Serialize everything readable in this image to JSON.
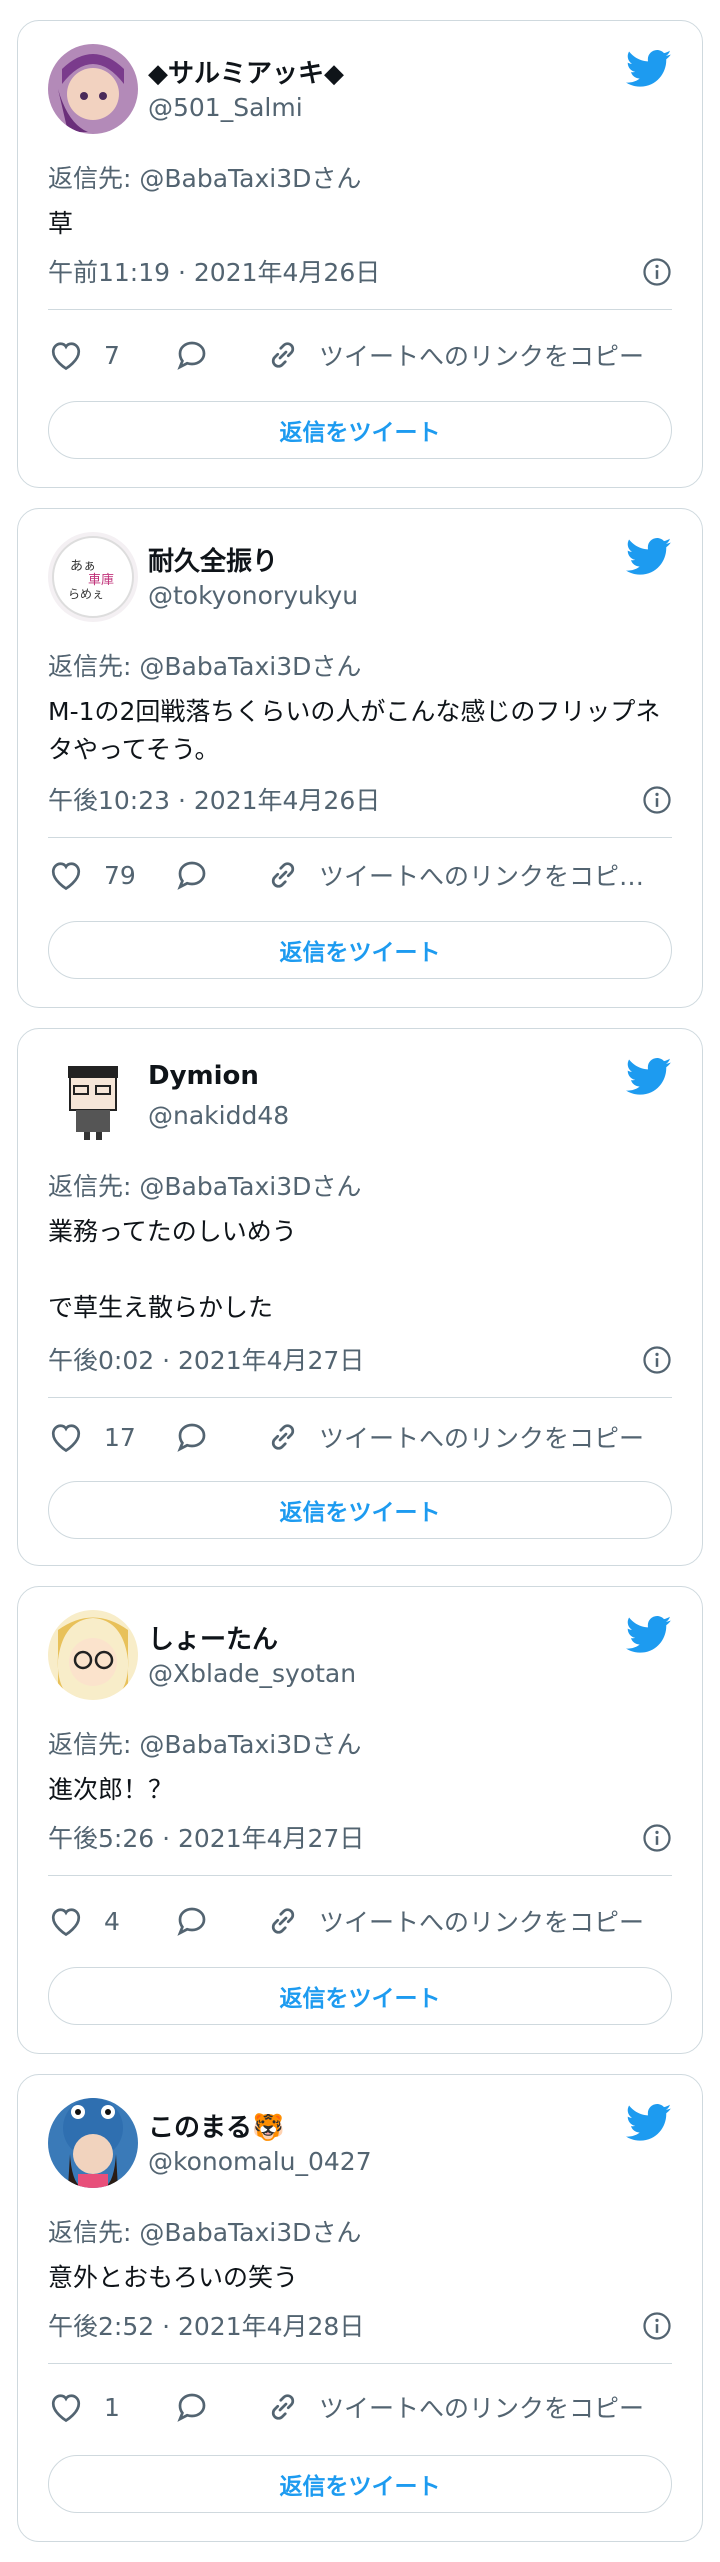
{
  "colors": {
    "twitter_blue": "#1d9bf0",
    "gray_text": "#536471",
    "border": "#cfd9de"
  },
  "tweets": [
    {
      "name": "◆サルミアッキ◆",
      "handle": "@501_Salmi",
      "reply_to": "返信先: @BabaTaxi3Dさん",
      "text": "草",
      "timestamp": "午前11:19 · 2021年4月26日",
      "likes": "7",
      "copy_link": "ツイートへのリンクをコピー",
      "reply_button": "返信をツイート",
      "icons": {
        "like": "heart-icon",
        "reply": "speech-bubble-icon",
        "link": "link-icon",
        "info": "info-icon",
        "brand": "twitter-bird-icon"
      }
    },
    {
      "name": "耐久全振り",
      "handle": "@tokyonoryukyu",
      "reply_to": "返信先: @BabaTaxi3Dさん",
      "text": "M-1の2回戦落ちくらいの人がこんな感じのフリップネタやってそう。",
      "timestamp": "午後10:23 · 2021年4月26日",
      "likes": "79",
      "copy_link": "ツイートへのリンクをコピ…",
      "reply_button": "返信をツイート"
    },
    {
      "name": "Dymion",
      "handle": "@nakidd48",
      "reply_to": "返信先: @BabaTaxi3Dさん",
      "text": "業務ってたのしいめう\n\nで草生え散らかした",
      "timestamp": "午後0:02 · 2021年4月27日",
      "likes": "17",
      "copy_link": "ツイートへのリンクをコピー",
      "reply_button": "返信をツイート"
    },
    {
      "name": "しょーたん",
      "handle": "@Xblade_syotan",
      "reply_to": "返信先: @BabaTaxi3Dさん",
      "text": "進次郎！？",
      "timestamp": "午後5:26 · 2021年4月27日",
      "likes": "4",
      "copy_link": "ツイートへのリンクをコピー",
      "reply_button": "返信をツイート"
    },
    {
      "name": "このまる🐯",
      "handle": "@konomalu_0427",
      "reply_to": "返信先: @BabaTaxi3Dさん",
      "text": "意外とおもろいの笑う",
      "timestamp": "午後2:52 · 2021年4月28日",
      "likes": "1",
      "copy_link": "ツイートへのリンクをコピー",
      "reply_button": "返信をツイート"
    }
  ]
}
